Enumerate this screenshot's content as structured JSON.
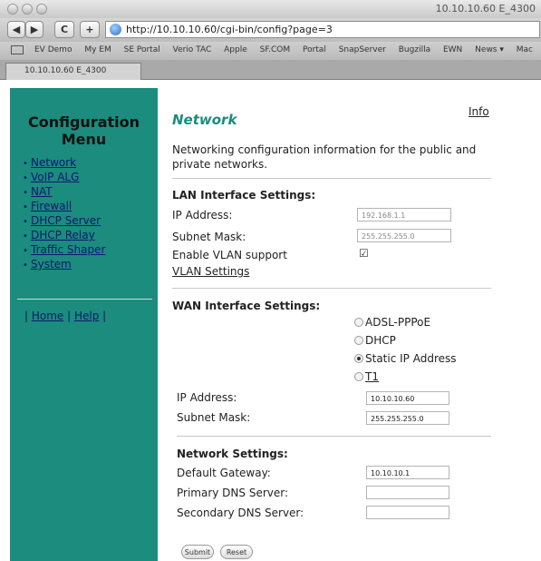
{
  "browser": {
    "window_title": "10.10.10.60 E_4300",
    "back_glyph": "◀",
    "forward_glyph": "▶",
    "reload_glyph": "C",
    "add_glyph": "+",
    "url": "http://10.10.10.60/cgi-bin/config?page=3",
    "bookmarks": [
      "EV Demo",
      "My EM",
      "SE Portal",
      "Verio TAC",
      "Apple",
      "SF.COM",
      "Portal",
      "SnapServer",
      "Bugzilla",
      "EWN",
      "News ▾",
      "Mac"
    ],
    "tab_title": "10.10.10.60 E_4300"
  },
  "sidebar": {
    "title": "Configuration Menu",
    "items": [
      "Network",
      "VoIP ALG",
      "NAT",
      "Firewall",
      "DHCP Server",
      "DHCP Relay",
      "Traffic Shaper",
      "System"
    ],
    "home_label": "Home",
    "help_label": "Help"
  },
  "main": {
    "info_link": "Info",
    "title": "Network",
    "description": "Networking configuration information for the public and private networks.",
    "lan": {
      "section_title": "LAN Interface Settings:",
      "ip_label": "IP Address:",
      "ip_value": "192.168.1.1",
      "mask_label": "Subnet Mask:",
      "mask_value": "255.255.255.0",
      "vlan_label": "Enable VLAN support",
      "vlan_checked": true,
      "vlan_settings_link": "VLAN Settings"
    },
    "wan": {
      "section_title": "WAN Interface Settings:",
      "options": [
        "ADSL-PPPoE",
        "DHCP",
        "Static IP Address",
        "T1"
      ],
      "selected": "Static IP Address",
      "ip_label": "IP Address:",
      "ip_value": "10.10.10.60",
      "mask_label": "Subnet Mask:",
      "mask_value": "255.255.255.0"
    },
    "network": {
      "section_title": "Network Settings:",
      "gateway_label": "Default Gateway:",
      "gateway_value": "10.10.10.1",
      "dns1_label": "Primary DNS Server:",
      "dns1_value": "",
      "dns2_label": "Secondary DNS Server:",
      "dns2_value": ""
    },
    "submit_label": "Submit",
    "reset_label": "Reset"
  }
}
